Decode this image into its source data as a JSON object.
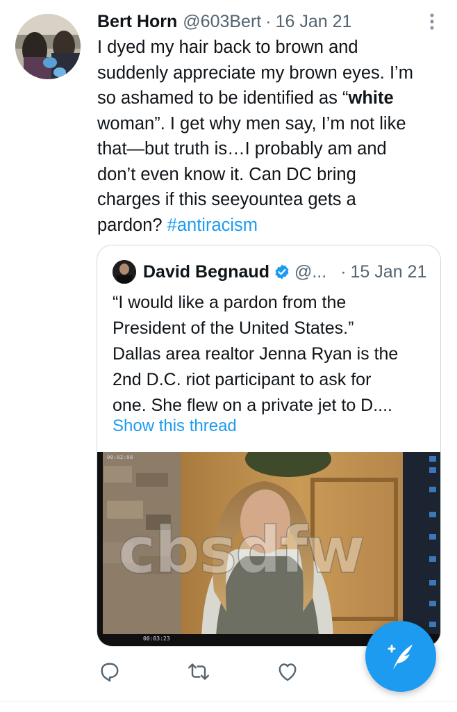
{
  "tweet": {
    "author_name": "Bert Horn",
    "author_handle": "@603Bert",
    "separator": "·",
    "date": "16 Jan 21",
    "text_line_1": "I dyed my hair back to brown and",
    "text_line_2": "suddenly appreciate my brown eyes. I’m",
    "text_line_3_a": "so ashamed to be identified as “",
    "text_line_3_bold": "white",
    "text_line_4": "woman”. I get why men say, I’m not like",
    "text_line_5": "that—but truth is…I probably am and",
    "text_line_6": "don’t even know it. Can DC bring",
    "text_line_7": "charges if this seeyountea gets a",
    "text_line_8_a": "pardon? ",
    "hashtag": "#antiracism"
  },
  "quoted": {
    "author_name": "David Begnaud",
    "author_handle": "@...",
    "separator": "·",
    "date": "15 Jan 21",
    "text_line_1": "“I would like a pardon from the",
    "text_line_2": "President of the United States.”",
    "text_line_3": "Dallas area realtor Jenna Ryan is the",
    "text_line_4": "2nd D.C. riot participant to ask for",
    "text_line_5": "one. She flew on a private jet to D....",
    "show_thread": "Show this thread",
    "watermark": "cbsdfw",
    "video_timestamp_1": "00:02:08",
    "video_timestamp_2": "00:03:23"
  },
  "icons": {
    "more": "more-vertical-icon",
    "verified": "verified-badge-icon",
    "reply": "reply-icon",
    "retweet": "retweet-icon",
    "like": "like-icon",
    "compose": "compose-tweet-icon"
  },
  "colors": {
    "accent": "#1d9bf0",
    "text": "#0f1419",
    "secondary": "#536471",
    "border": "#cfd9de"
  }
}
